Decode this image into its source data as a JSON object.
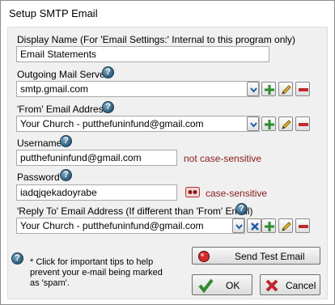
{
  "window": {
    "title": "Setup SMTP Email"
  },
  "display_name": {
    "label": "Display Name (For 'Email Settings:' Internal  to this program only)",
    "value": "Email Statements"
  },
  "outgoing_server": {
    "label": "Outgoing Mail Server",
    "value": "smtp.gmail.com"
  },
  "from_address": {
    "label": "'From' Email Address",
    "value": "Your Church - putthefuninfund@gmail.com"
  },
  "username": {
    "label": "Username",
    "value": "putthefuninfund@gmail.com",
    "note": "not case-sensitive"
  },
  "password": {
    "label": "Password",
    "value": "iadqjqekadoyrabe",
    "note": "case-sensitive"
  },
  "reply_to": {
    "label": "'Reply To' Email Address (If different than 'From' Email)",
    "value": "Your Church - putthefuninfund@gmail.com"
  },
  "help_glyph": "?",
  "tip": {
    "text": "* Click for important tips to help prevent your e-mail being marked as 'spam'."
  },
  "buttons": {
    "send_test": "Send Test Email",
    "ok": "OK",
    "cancel": "Cancel"
  },
  "icons": {
    "help": "help-question-icon",
    "dropdown": "chevron-down-icon",
    "add": "plus-icon",
    "edit": "pencil-icon",
    "delete": "minus-icon",
    "clear": "x-icon",
    "show_password": "eye-mask-icon",
    "record": "red-record-icon",
    "ok": "green-check-icon",
    "cancel": "red-x-icon"
  },
  "colors": {
    "note_red": "#8b1a1a",
    "help_blue": "#2d5d7b",
    "add_green": "#2e8b2e",
    "delete_red": "#c0282d",
    "dropdown_blue": "#1e5aa8"
  }
}
